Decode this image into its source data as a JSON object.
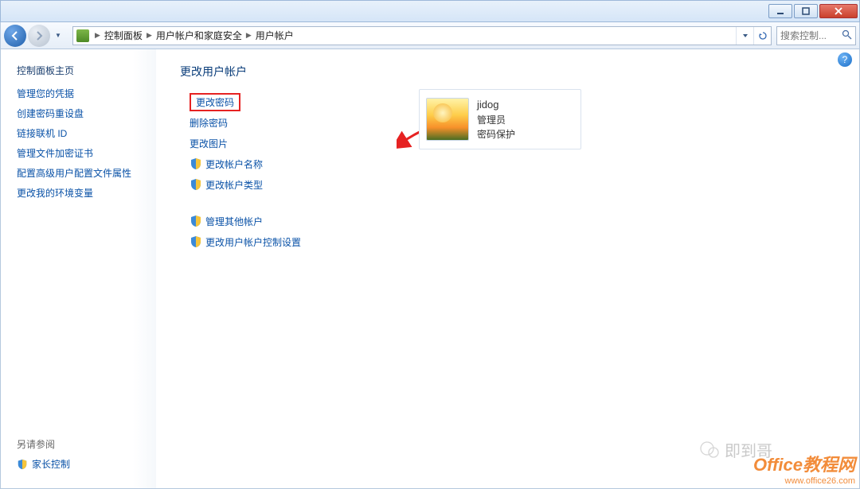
{
  "breadcrumb": {
    "root": "控制面板",
    "level1": "用户帐户和家庭安全",
    "level2": "用户帐户"
  },
  "search": {
    "placeholder": "搜索控制..."
  },
  "sidebar": {
    "title": "控制面板主页",
    "links": [
      "管理您的凭据",
      "创建密码重设盘",
      "链接联机 ID",
      "管理文件加密证书",
      "配置高级用户配置文件属性",
      "更改我的环境变量"
    ],
    "see_also_label": "另请参阅",
    "see_also_link": "家长控制"
  },
  "content": {
    "heading": "更改用户帐户",
    "tasks": {
      "change_password": "更改密码",
      "remove_password": "删除密码",
      "change_picture": "更改图片",
      "change_name": "更改帐户名称",
      "change_type": "更改帐户类型",
      "manage_other": "管理其他帐户",
      "uac_settings": "更改用户帐户控制设置"
    }
  },
  "user": {
    "name": "jidog",
    "role": "管理员",
    "protection": "密码保护"
  },
  "watermark": {
    "brand": "Office教程网",
    "url": "www.office26.com",
    "chat": "即到哥"
  }
}
